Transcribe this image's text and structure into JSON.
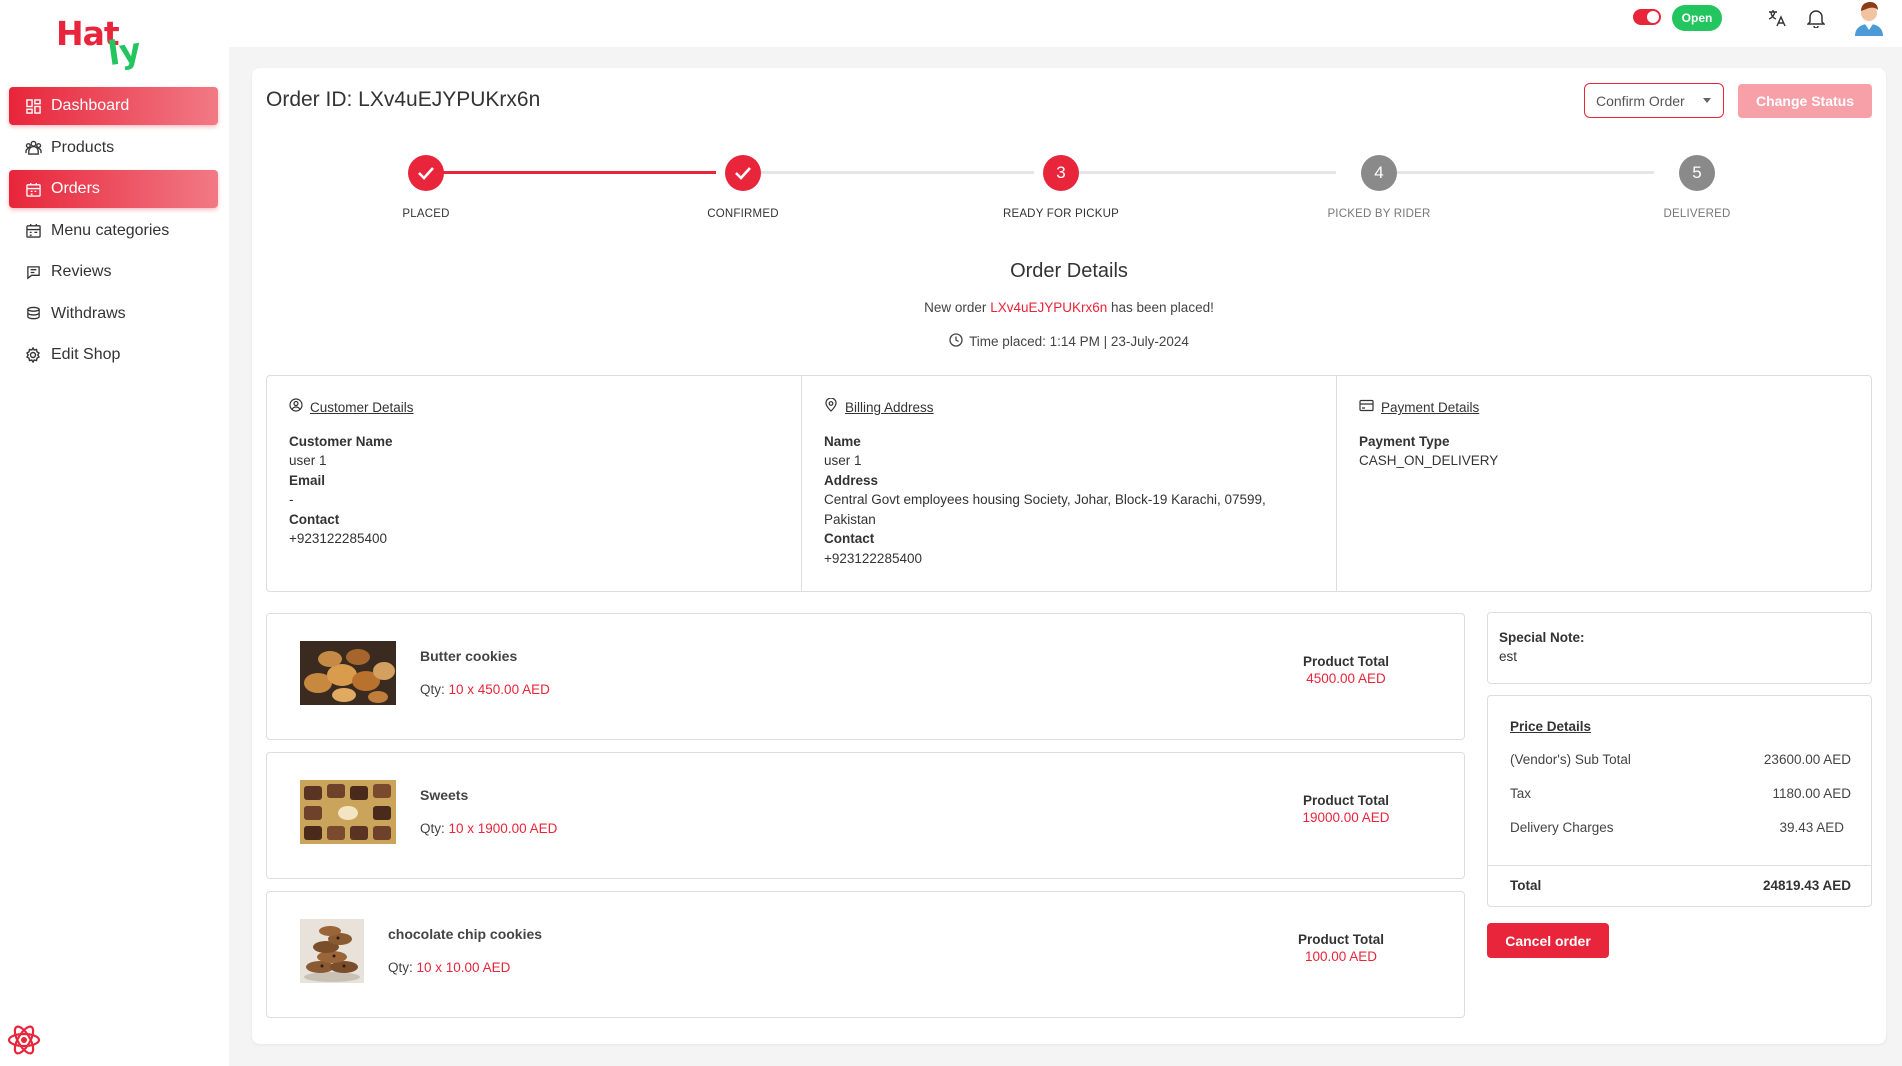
{
  "brand": {
    "logo_part1": "Hat",
    "logo_part2": "ly"
  },
  "sidebar": {
    "items": [
      {
        "label": "Dashboard",
        "icon": "dashboard-icon",
        "active": true
      },
      {
        "label": "Products",
        "icon": "products-icon",
        "active": false
      },
      {
        "label": "Orders",
        "icon": "orders-icon",
        "active": true
      },
      {
        "label": "Menu categories",
        "icon": "menu-categories-icon",
        "active": false
      },
      {
        "label": "Reviews",
        "icon": "reviews-icon",
        "active": false
      },
      {
        "label": "Withdraws",
        "icon": "withdraws-icon",
        "active": false
      },
      {
        "label": "Edit Shop",
        "icon": "settings-icon",
        "active": false
      }
    ]
  },
  "topbar": {
    "shop_status": "Open"
  },
  "order": {
    "title": "Order ID: LXv4uEJYPUKrx6n",
    "status_select_value": "Confirm Order",
    "change_status_label": "Change Status",
    "steps": [
      {
        "label": "PLACED",
        "state": "done",
        "number": "1"
      },
      {
        "label": "CONFIRMED",
        "state": "done",
        "number": "2"
      },
      {
        "label": "READY FOR PICKUP",
        "state": "current",
        "number": "3"
      },
      {
        "label": "PICKED BY RIDER",
        "state": "pending",
        "number": "4"
      },
      {
        "label": "DELIVERED",
        "state": "pending",
        "number": "5"
      }
    ],
    "details_title": "Order Details",
    "placed_prefix": "New order ",
    "placed_id": "LXv4uEJYPUKrx6n",
    "placed_suffix": " has been placed!",
    "time_placed": "Time placed: 1:14 PM | 23-July-2024"
  },
  "customer": {
    "heading": "Customer Details",
    "name_label": "Customer Name",
    "name": "user 1",
    "email_label": "Email",
    "email": "-",
    "contact_label": "Contact",
    "contact": "+923122285400"
  },
  "billing": {
    "heading": "Billing Address",
    "name_label": "Name",
    "name": "user 1",
    "address_label": "Address",
    "address_line1": "Central Govt employees housing Society, Johar, Block-19 Karachi, 07599,",
    "address_line2": "Pakistan",
    "contact_label": "Contact",
    "contact": "+923122285400"
  },
  "payment": {
    "heading": "Payment Details",
    "type_label": "Payment Type",
    "type": "CASH_ON_DELIVERY"
  },
  "products": [
    {
      "name": "Butter cookies",
      "qty_label": "Qty: ",
      "qty": "10 x 450.00 AED",
      "total_label": "Product Total",
      "total": "4500.00 AED"
    },
    {
      "name": "Sweets",
      "qty_label": "Qty: ",
      "qty": "10 x 1900.00 AED",
      "total_label": "Product Total",
      "total": "19000.00 AED"
    },
    {
      "name": "chocolate chip cookies",
      "qty_label": "Qty: ",
      "qty": "10 x 10.00 AED",
      "total_label": "Product Total",
      "total": "100.00 AED"
    }
  ],
  "note": {
    "label": "Special Note:",
    "text": "est"
  },
  "price": {
    "heading": "Price Details",
    "subtotal_label": "(Vendor's) Sub Total",
    "subtotal": "23600.00 AED",
    "tax_label": "Tax",
    "tax": "1180.00 AED",
    "delivery_label": "Delivery Charges",
    "delivery": "39.43 AED",
    "total_label": "Total",
    "total": "24819.43 AED"
  },
  "actions": {
    "cancel_label": "Cancel order"
  },
  "colors": {
    "primary": "#e8253a",
    "success": "#22c55e",
    "muted": "#8a8a8a",
    "disabled_primary": "#f7a0a8"
  }
}
